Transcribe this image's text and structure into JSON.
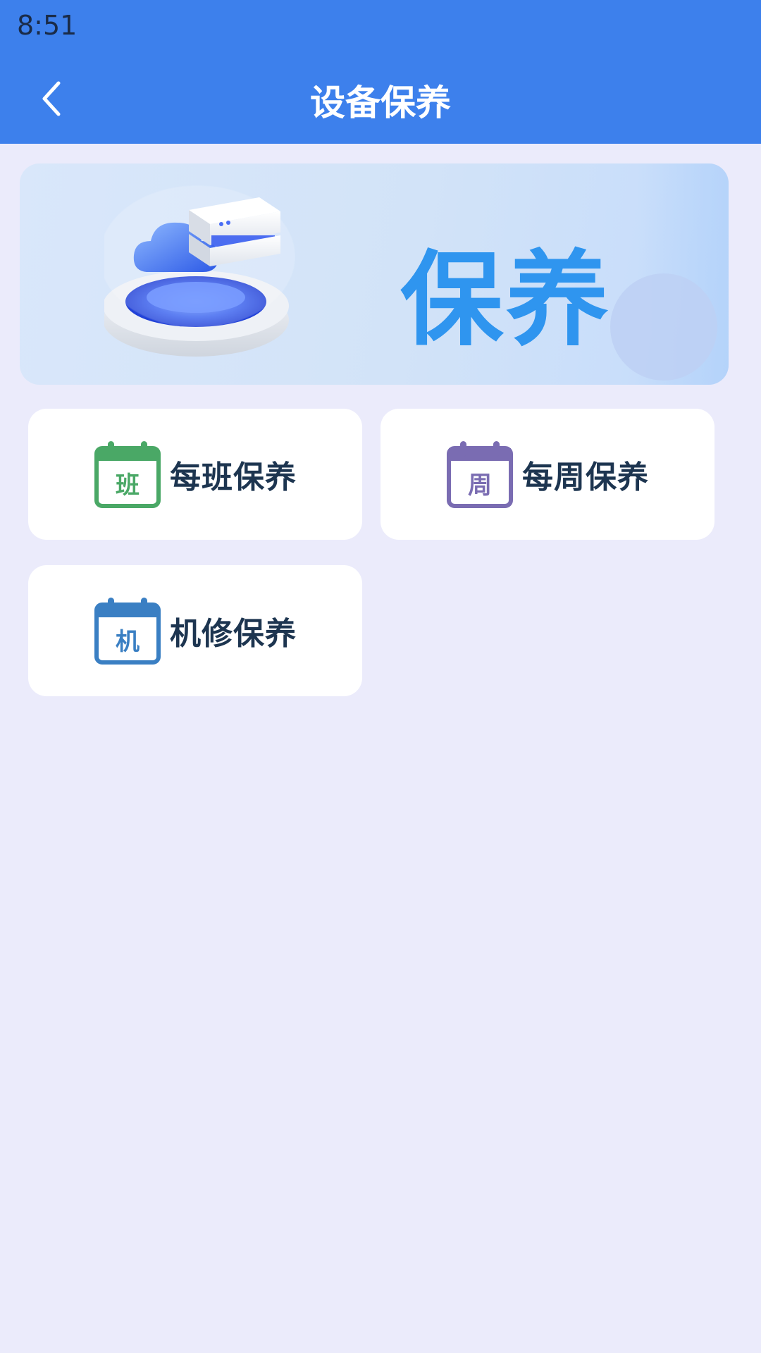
{
  "status_bar": {
    "time": "8:51"
  },
  "app_bar": {
    "title": "设备保养",
    "back_icon": "chevron-left-icon"
  },
  "banner": {
    "text": "保养",
    "illustration": "cloud-server-illustration"
  },
  "menu": [
    {
      "label": "每班保养",
      "icon_char": "班",
      "icon": "calendar-icon",
      "color": "#4aa866"
    },
    {
      "label": "每周保养",
      "icon_char": "周",
      "icon": "calendar-icon",
      "color": "#7a6cb2"
    },
    {
      "label": "机修保养",
      "icon_char": "机",
      "icon": "calendar-icon",
      "color": "#3a7fc3"
    }
  ],
  "colors": {
    "header": "#3d80ec",
    "background": "#ebebfb",
    "banner_text": "#2f95ef",
    "card_label": "#1d3550"
  }
}
